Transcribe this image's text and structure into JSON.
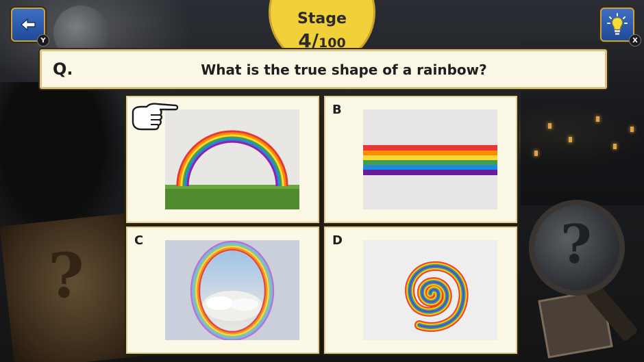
{
  "buttons": {
    "back": {
      "icon": "arrow-left-icon",
      "key": "Y"
    },
    "hint": {
      "icon": "lightbulb-icon",
      "key": "X"
    }
  },
  "stage": {
    "title": "Stage",
    "current": "4",
    "separator": "/",
    "total": "100"
  },
  "question": {
    "label": "Q.",
    "text": "What is the true shape of a rainbow?"
  },
  "options": [
    {
      "letter": "",
      "picture": "rainbow-arch-over-grass",
      "selected": true
    },
    {
      "letter": "B",
      "picture": "rainbow-horizontal-band"
    },
    {
      "letter": "C",
      "picture": "rainbow-full-circle-over-clouds"
    },
    {
      "letter": "D",
      "picture": "rainbow-spiral"
    }
  ],
  "colors": {
    "stage_badge": "#f2d03a",
    "button_blue": "#2a5bb0",
    "card_bg": "#fbf8e6"
  }
}
